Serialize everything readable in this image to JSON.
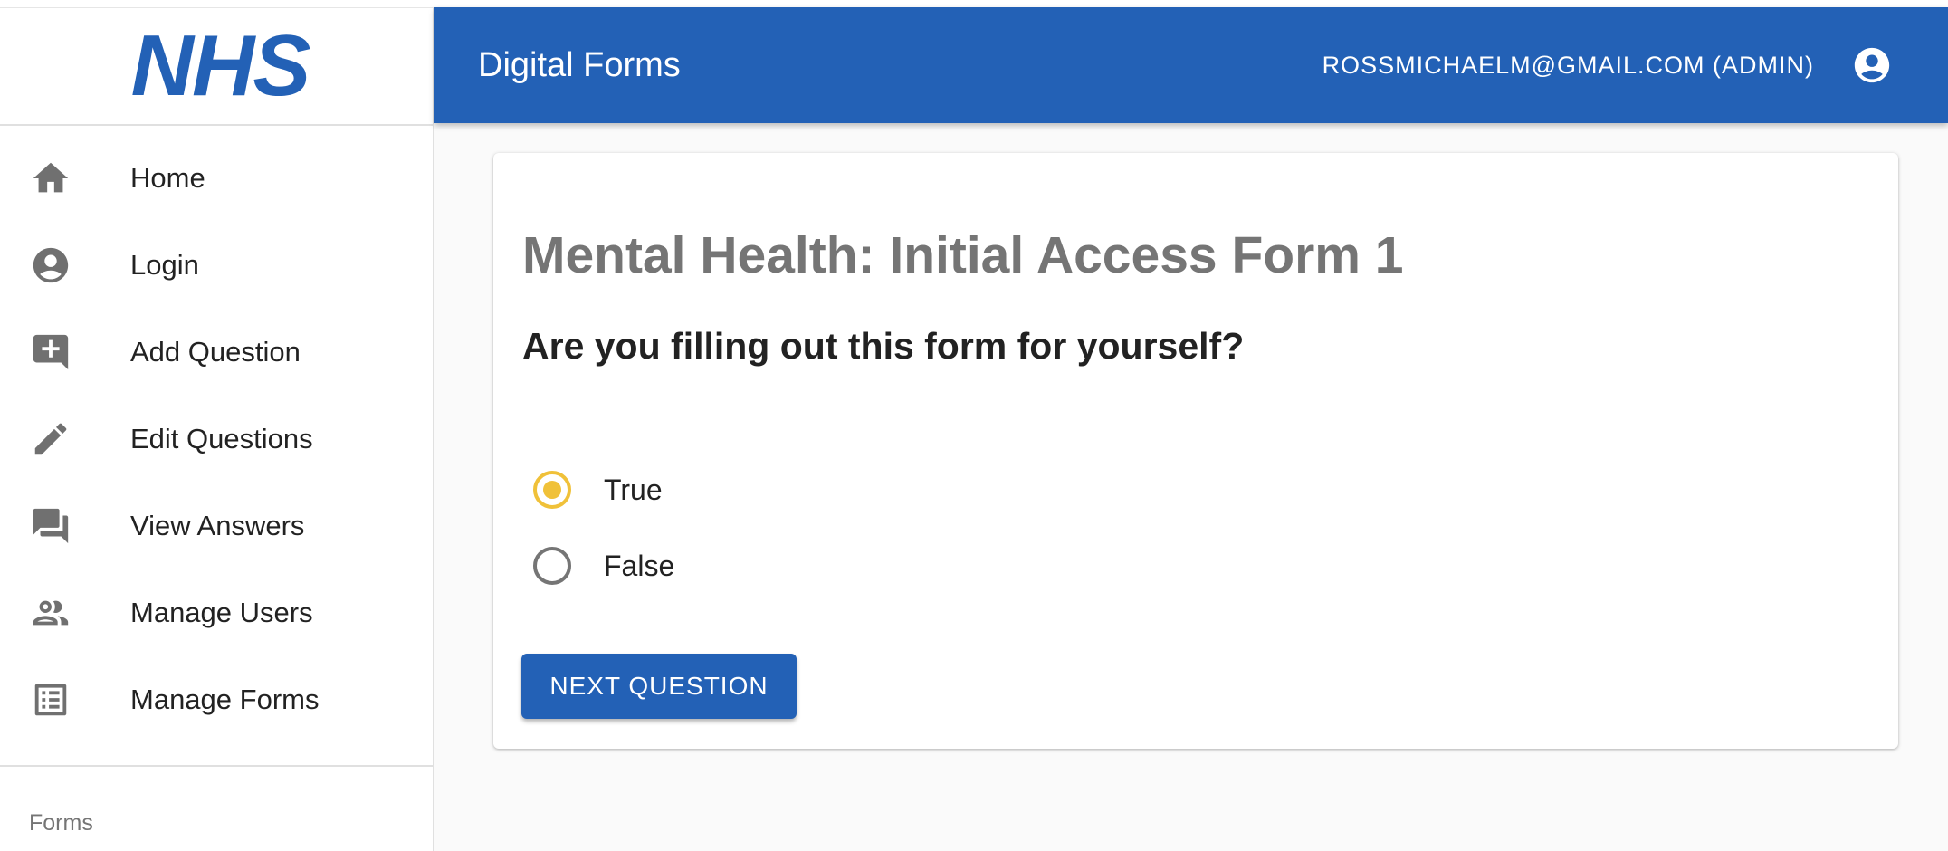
{
  "sidebar": {
    "logo": "NHS",
    "items": [
      {
        "label": "Home",
        "icon": "home-icon"
      },
      {
        "label": "Login",
        "icon": "account-circle-icon"
      },
      {
        "label": "Add Question",
        "icon": "add-comment-icon"
      },
      {
        "label": "Edit Questions",
        "icon": "pencil-icon"
      },
      {
        "label": "View Answers",
        "icon": "forum-icon"
      },
      {
        "label": "Manage Users",
        "icon": "people-icon"
      },
      {
        "label": "Manage Forms",
        "icon": "list-alt-icon"
      }
    ],
    "section_label": "Forms"
  },
  "header": {
    "title": "Digital Forms",
    "user": "ROSSMICHAELM@GMAIL.COM (ADMIN)",
    "avatar_icon": "account-circle-icon"
  },
  "form": {
    "title": "Mental Health: Initial Access Form 1",
    "question": "Are you filling out this form for yourself?",
    "options": [
      {
        "label": "True",
        "selected": true
      },
      {
        "label": "False",
        "selected": false
      }
    ],
    "next_label": "NEXT QUESTION"
  },
  "colors": {
    "brand_blue": "#2361b6",
    "radio_selected": "#f0c139",
    "icon_gray": "#707070"
  }
}
